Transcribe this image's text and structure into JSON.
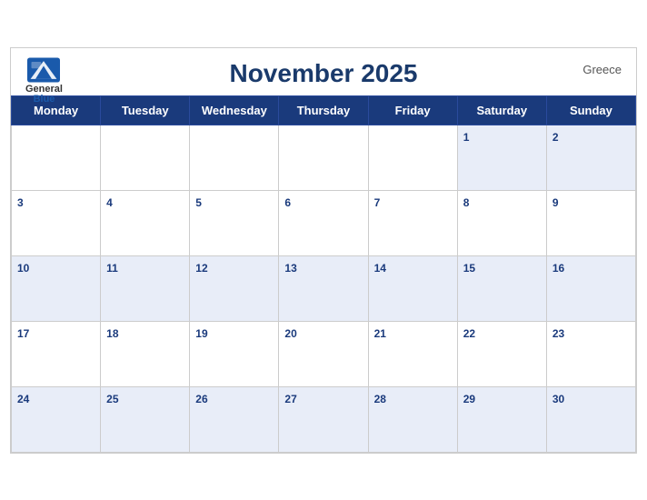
{
  "calendar": {
    "title": "November 2025",
    "country": "Greece",
    "logo": {
      "general": "General",
      "blue": "Blue"
    },
    "days_of_week": [
      "Monday",
      "Tuesday",
      "Wednesday",
      "Thursday",
      "Friday",
      "Saturday",
      "Sunday"
    ],
    "weeks": [
      [
        null,
        null,
        null,
        null,
        null,
        1,
        2
      ],
      [
        3,
        4,
        5,
        6,
        7,
        8,
        9
      ],
      [
        10,
        11,
        12,
        13,
        14,
        15,
        16
      ],
      [
        17,
        18,
        19,
        20,
        21,
        22,
        23
      ],
      [
        24,
        25,
        26,
        27,
        28,
        29,
        30
      ]
    ]
  }
}
